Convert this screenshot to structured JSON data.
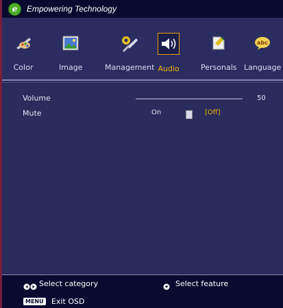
{
  "header": {
    "title": "Empowering Technology",
    "logo_letter": "e"
  },
  "tabs": [
    {
      "label": "Color",
      "icon": "color-palette-icon",
      "active": false
    },
    {
      "label": "Image",
      "icon": "image-icon",
      "active": false
    },
    {
      "label": "Management",
      "icon": "tools-icon",
      "active": false
    },
    {
      "label": "Audio",
      "icon": "speaker-icon",
      "active": true
    },
    {
      "label": "Personals",
      "icon": "personals-icon",
      "active": false
    },
    {
      "label": "Language",
      "icon": "abc-speech-bubble-icon",
      "active": false
    }
  ],
  "audio": {
    "volume_label": "Volume",
    "volume_value": "50",
    "volume_level": 0.5,
    "mute_label": "Mute",
    "mute_on": "On",
    "mute_off": "[Off]",
    "mute_selected": "Off"
  },
  "footer": {
    "select_category": "Select category",
    "select_feature": "Select feature",
    "menu_key": "MENU",
    "exit": "Exit OSD"
  },
  "colors": {
    "accent": "#f0b000",
    "background": "#2a2c5c",
    "header_bg": "#0a0a30",
    "border": "#7a1f3a"
  }
}
